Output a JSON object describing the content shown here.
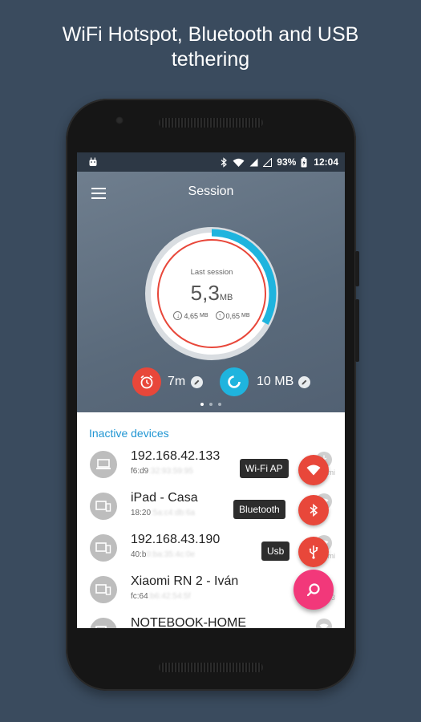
{
  "headline": {
    "line1": "WiFi Hotspot, Bluetooth and USB",
    "line2": "tethering"
  },
  "statusbar": {
    "battery_percent": "93%",
    "time": "12:04",
    "icons": [
      "android-icon",
      "bluetooth-icon",
      "wifi-icon",
      "signal-icon",
      "no-signal-icon",
      "battery-charging-icon"
    ]
  },
  "toolbar": {
    "title": "Session",
    "menu_icon": "hamburger-menu-icon"
  },
  "session": {
    "label": "Last session",
    "value": "5,3",
    "unit": "MB",
    "download": "4,65",
    "download_unit": "MB",
    "upload": "0,65",
    "upload_unit": "MB",
    "progress_fraction": 0.33
  },
  "stats": {
    "timer_value": "7m",
    "data_limit_value": "10 MB"
  },
  "pager": {
    "count": 3,
    "active": 0
  },
  "devices": {
    "section_title": "Inactive devices",
    "items": [
      {
        "name": "192.168.42.133",
        "mac_visible": "f6:d9",
        "mac_hidden": ":32:93:59:95",
        "side_text": "mi"
      },
      {
        "name": "iPad - Casa",
        "mac_visible": "18:20",
        "mac_hidden": ":5a:c4:db:6a",
        "side_text": ""
      },
      {
        "name": "192.168.43.190",
        "mac_visible": "40:b",
        "mac_hidden": "0:ba:35:4c:0e",
        "side_text": "mi"
      },
      {
        "name": "Xiaomi RN 2 - Iván",
        "mac_visible": "fc:64",
        "mac_hidden": ":b6:42:54:5f",
        "side_text": "3"
      },
      {
        "name": "NOTEBOOK-HOME",
        "mac_visible": "",
        "mac_hidden": "",
        "side_text": ""
      }
    ]
  },
  "fab_menu": {
    "wifi_label": "Wi-Fi AP",
    "bluetooth_label": "Bluetooth",
    "usb_label": "Usb"
  },
  "colors": {
    "background": "#3a4b5e",
    "accent_red": "#e8473a",
    "accent_cyan": "#1fb4de",
    "fab_pink": "#f2387a",
    "section_blue": "#2196d3"
  }
}
